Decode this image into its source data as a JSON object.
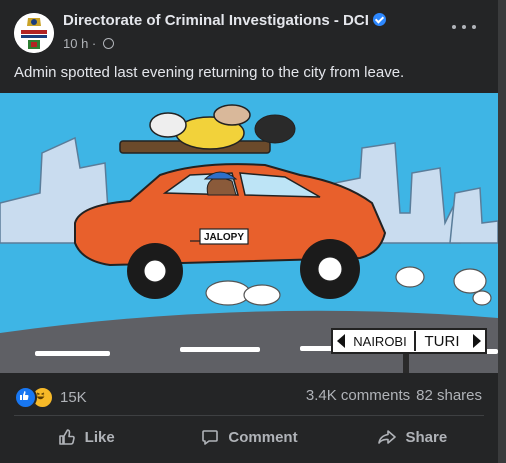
{
  "post": {
    "page_name": "Directorate of Criminal Investigations - DCI",
    "time": "10 h",
    "caption": "Admin spotted last evening returning to the city from leave.",
    "avatar_text": [
      "#FICHUAKWADCI",
      "0800 722 203"
    ]
  },
  "image": {
    "car_label": "JALOPY",
    "sign_left": "NAIROBI",
    "sign_right": "TURI",
    "colors": {
      "sky": "#3eb5e5",
      "car": "#e8602c",
      "road": "#5f6065",
      "buildings": "#c9dcef"
    }
  },
  "engagement": {
    "reactions_count": "15K",
    "comments": "3.4K comments",
    "shares": "82 shares"
  },
  "actions": {
    "like": "Like",
    "comment": "Comment",
    "share": "Share"
  },
  "icons": [
    "verified-badge-icon",
    "globe-icon",
    "more-options-icon",
    "like-reaction-icon",
    "haha-reaction-icon",
    "thumbs-up-icon",
    "comment-icon",
    "share-icon"
  ]
}
